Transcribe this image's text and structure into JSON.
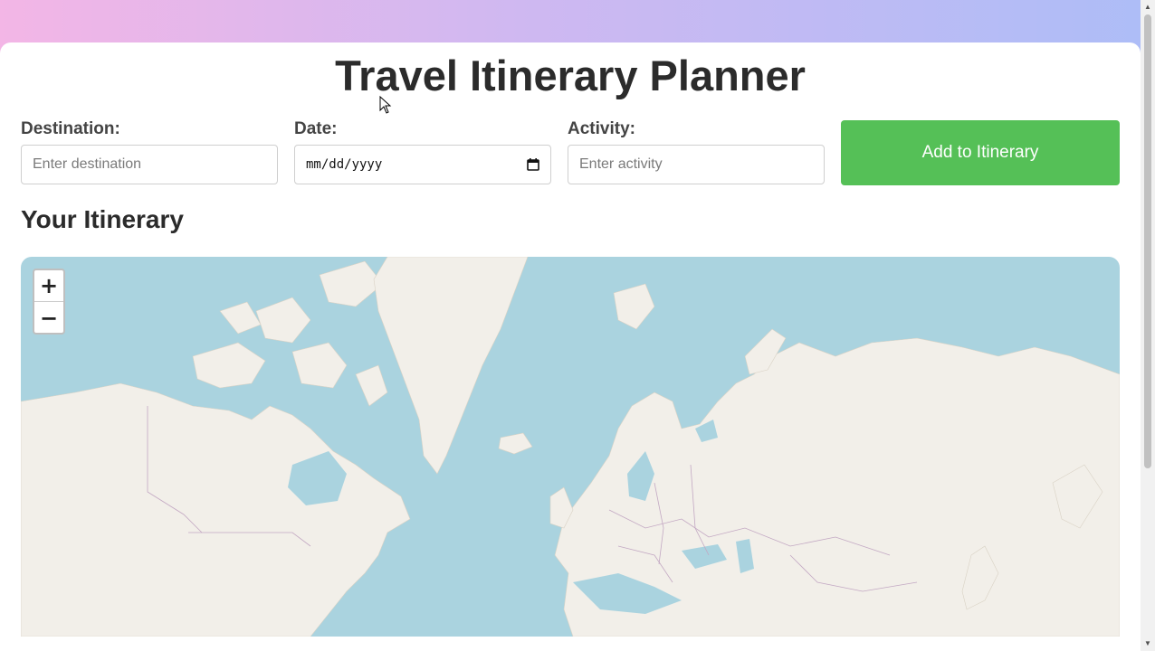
{
  "page": {
    "title": "Travel Itinerary Planner",
    "itinerary_heading": "Your Itinerary"
  },
  "form": {
    "destination": {
      "label": "Destination:",
      "placeholder": "Enter destination",
      "value": ""
    },
    "date": {
      "label": "Date:",
      "display": "mm/dd/yyyy"
    },
    "activity": {
      "label": "Activity:",
      "placeholder": "Enter activity",
      "value": ""
    },
    "add_button": "Add to Itinerary"
  },
  "map": {
    "zoom_in": "+",
    "zoom_out": "−",
    "colors": {
      "water": "#aad3df",
      "land": "#f2efe9",
      "border": "#c3a8c3"
    }
  },
  "theme": {
    "accent": "#55c057",
    "gradient_start": "#f3b6e6",
    "gradient_end": "#adbdf7"
  },
  "icons": {
    "date_picker": "calendar-icon",
    "cursor": "mouse-pointer-icon"
  }
}
